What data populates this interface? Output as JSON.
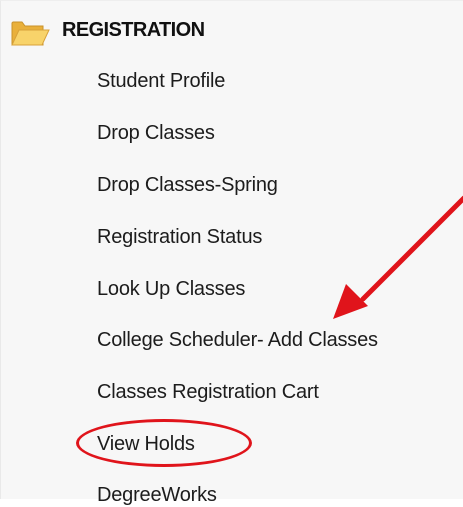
{
  "section": {
    "title": "REGISTRATION",
    "icon": "open-folder-icon",
    "icon_color": "#f2c34c"
  },
  "menu": {
    "items": [
      {
        "label": "Student Profile"
      },
      {
        "label": "Drop Classes"
      },
      {
        "label": "Drop Classes-Spring"
      },
      {
        "label": "Registration Status"
      },
      {
        "label": "Look Up Classes"
      },
      {
        "label": "College Scheduler- Add Classes"
      },
      {
        "label": "Classes Registration Cart"
      },
      {
        "label": "View Holds"
      },
      {
        "label": "DegreeWorks"
      }
    ]
  },
  "annotations": {
    "color": "#e0141b",
    "arrow": "red-arrow-annotation",
    "circle": "red-circle-annotation"
  }
}
